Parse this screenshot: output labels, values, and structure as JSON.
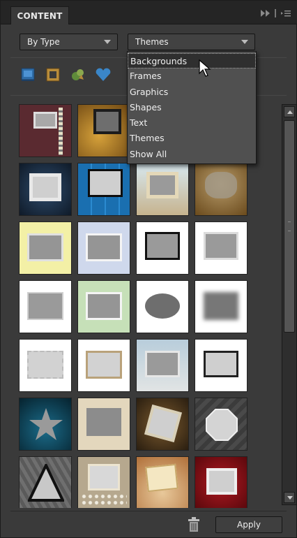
{
  "panel": {
    "tab_label": "CONTENT",
    "header_icons": [
      "fast-forward-icon",
      "pipe-icon",
      "menu-icon"
    ]
  },
  "filters": {
    "type_dropdown": {
      "value": "By Type"
    },
    "category_dropdown": {
      "value": "Themes"
    }
  },
  "type_icons": [
    "backgrounds-icon",
    "frames-icon",
    "graphics-icon",
    "shapes-icon"
  ],
  "menu": {
    "selected_index": 0,
    "items": [
      "Backgrounds",
      "Frames",
      "Graphics",
      "Shapes",
      "Text",
      "Themes",
      "Show All"
    ]
  },
  "footer": {
    "apply_label": "Apply",
    "trash_icon": "trash-icon"
  },
  "colors": {
    "panel_bg": "#3a3a3a",
    "header_bg": "#252525",
    "menu_bg": "#505050",
    "accent_blue": "#3a86c8"
  }
}
